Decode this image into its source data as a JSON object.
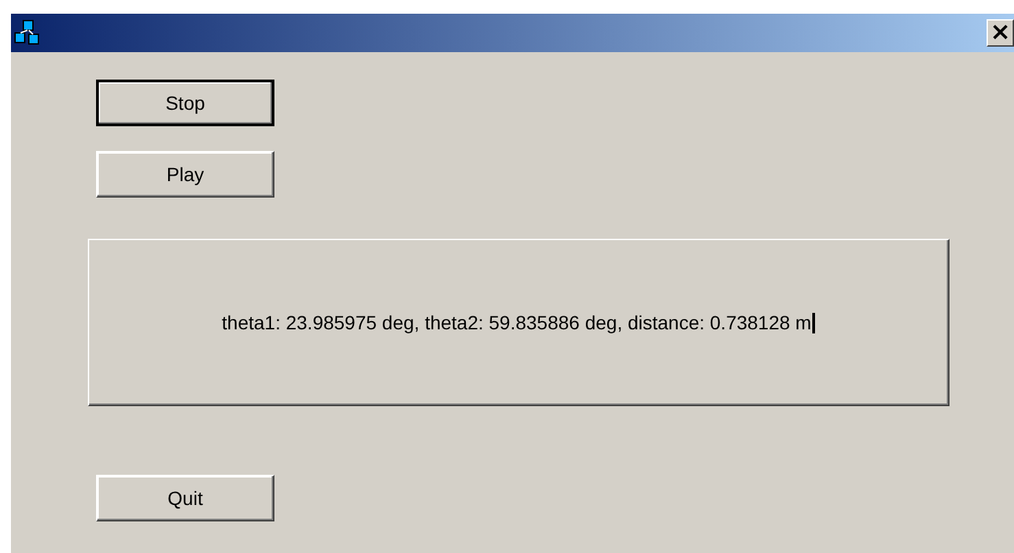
{
  "window": {
    "close_label": "×"
  },
  "buttons": [
    {
      "label": "Stop",
      "default": true
    },
    {
      "label": "Play",
      "default": false
    }
  ],
  "readout": {
    "text": "theta1: 23.985975 deg, theta2: 59.835886 deg, distance: 0.738128 m",
    "caret": true
  },
  "quit_button": {
    "label": "Quit",
    "default": false
  }
}
